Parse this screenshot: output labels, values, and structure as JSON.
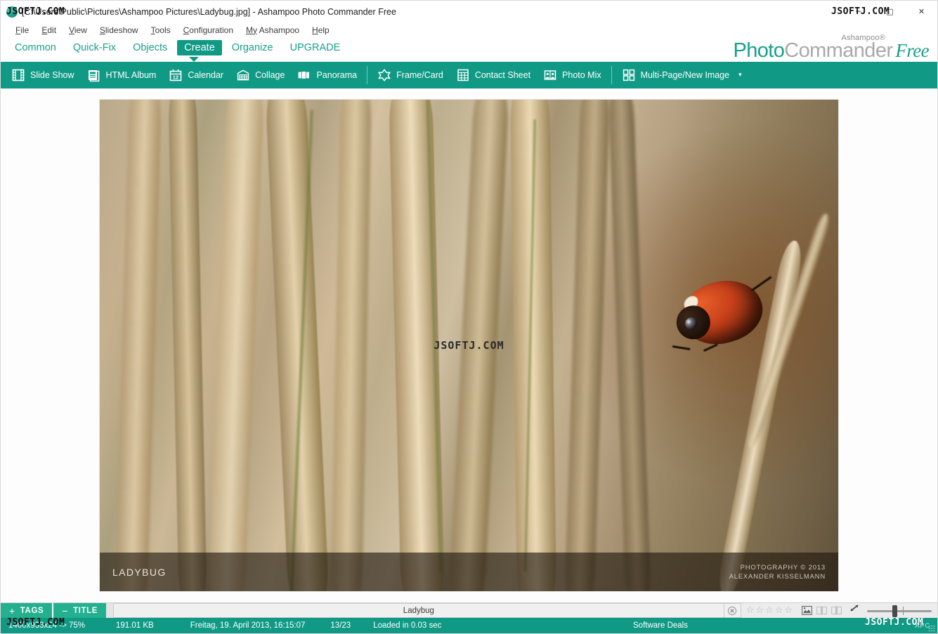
{
  "window": {
    "title": "[C:\\Users\\Public\\Pictures\\Ashampoo Pictures\\Ladybug.jpg] - Ashampoo Photo Commander Free",
    "app_icon": "ashampoo-logo-icon",
    "minimize": "─",
    "maximize": "□",
    "close": "✕"
  },
  "menubar": {
    "items": [
      {
        "acc": "F",
        "rest": "ile"
      },
      {
        "acc": "E",
        "rest": "dit"
      },
      {
        "acc": "V",
        "rest": "iew"
      },
      {
        "acc": "S",
        "rest": "lideshow"
      },
      {
        "acc": "T",
        "rest": "ools"
      },
      {
        "acc": "C",
        "rest": "onfiguration"
      },
      {
        "acc": "My",
        "rest": " Ashampoo"
      },
      {
        "acc": "H",
        "rest": "elp"
      }
    ]
  },
  "ribbon": {
    "tabs": [
      {
        "label": "Common",
        "active": false
      },
      {
        "label": "Quick-Fix",
        "active": false
      },
      {
        "label": "Objects",
        "active": false
      },
      {
        "label": "Create",
        "active": true
      },
      {
        "label": "Organize",
        "active": false
      },
      {
        "label": "UPGRADE",
        "active": false
      }
    ]
  },
  "logo": {
    "ashampoo": "Ashampoo®",
    "photo": "Photo",
    "commander": "Commander",
    "free": "Free"
  },
  "toolbar": {
    "items": [
      {
        "label": "Slide Show",
        "icon": "film-strip-icon"
      },
      {
        "label": "HTML Album",
        "icon": "document-page-icon"
      },
      {
        "label": "Calendar",
        "icon": "calendar-12-icon"
      },
      {
        "label": "Collage",
        "icon": "collage-grid-icon"
      },
      {
        "label": "Panorama",
        "icon": "panorama-bars-icon"
      },
      {
        "label": "Frame/Card",
        "icon": "star-frame-icon"
      },
      {
        "label": "Contact Sheet",
        "icon": "contact-sheet-grid-icon"
      },
      {
        "label": "Photo Mix",
        "icon": "photo-mix-people-icon"
      },
      {
        "label": "Multi-Page/New Image",
        "icon": "four-squares-icon",
        "caret": "▾"
      }
    ]
  },
  "photo": {
    "caption_title": "LADYBUG",
    "credit_line1": "PHOTOGRAPHY © 2013",
    "credit_line2": "ALEXANDER KISSELMANN"
  },
  "tagbar": {
    "tags_sign": "+",
    "tags_label": "TAGS",
    "title_sign": "−",
    "title_label": "TITLE",
    "title_value": "Ladybug",
    "title_placeholder": "Ladybug",
    "clear_icon": "clear-circle-x-icon",
    "star_glyph": "☆",
    "star_count": 5,
    "rating": 0,
    "zoom_fit_icon": "fit-to-window-icon"
  },
  "statusbar": {
    "dimensions": "1400x933x24 -> 75%",
    "filesize": "191.01 KB",
    "date": "Freitag, 19. April 2013, 16:15:07",
    "index": "13/23",
    "load_time": "Loaded in 0.03 sec",
    "deals": "Software Deals",
    "apc": "APC"
  },
  "watermarks": {
    "text": "JSOFTJ.COM"
  },
  "colors": {
    "accent": "#109a85",
    "accent_light": "#17a08c",
    "tag_green": "#22b08f",
    "logo_gray": "#a9a9a9"
  }
}
